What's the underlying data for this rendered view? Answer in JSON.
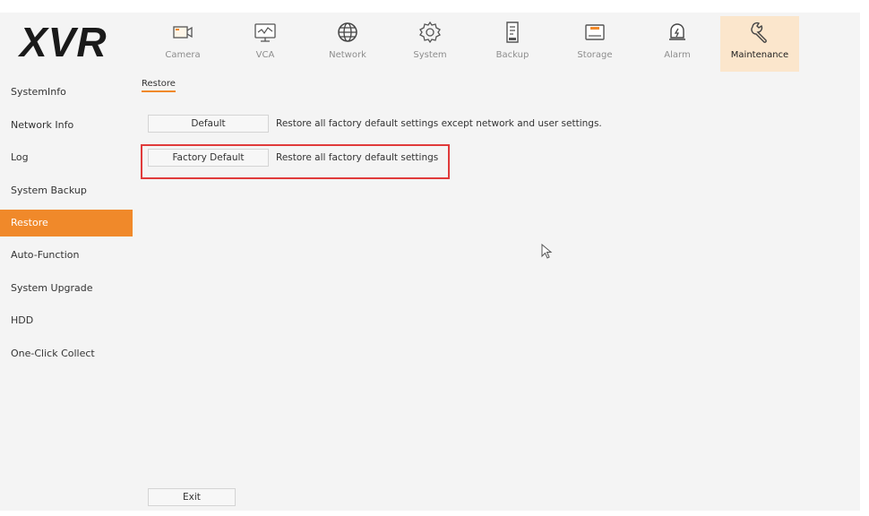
{
  "header": {
    "logo": "XVR",
    "nav": [
      {
        "label": "Camera",
        "icon": "camera-icon"
      },
      {
        "label": "VCA",
        "icon": "vca-icon"
      },
      {
        "label": "Network",
        "icon": "globe-icon"
      },
      {
        "label": "System",
        "icon": "gear-icon"
      },
      {
        "label": "Backup",
        "icon": "backup-icon"
      },
      {
        "label": "Storage",
        "icon": "storage-icon"
      },
      {
        "label": "Alarm",
        "icon": "alarm-icon"
      },
      {
        "label": "Maintenance",
        "icon": "wrench-icon",
        "active": true
      }
    ]
  },
  "sidebar": {
    "items": [
      {
        "label": "SystemInfo"
      },
      {
        "label": "Network Info"
      },
      {
        "label": "Log"
      },
      {
        "label": "System Backup"
      },
      {
        "label": "Restore",
        "active": true
      },
      {
        "label": "Auto-Function"
      },
      {
        "label": "System Upgrade"
      },
      {
        "label": "HDD"
      },
      {
        "label": "One-Click Collect"
      }
    ]
  },
  "main": {
    "tab": "Restore",
    "default_button": "Default",
    "default_desc": "Restore all factory default settings except network and user settings.",
    "factory_button": "Factory Default",
    "factory_desc": "Restore all factory default settings",
    "exit_button": "Exit"
  },
  "colors": {
    "accent": "#f0892a",
    "active_tab_bg": "#fbe6cc",
    "highlight": "#e03a3a"
  }
}
